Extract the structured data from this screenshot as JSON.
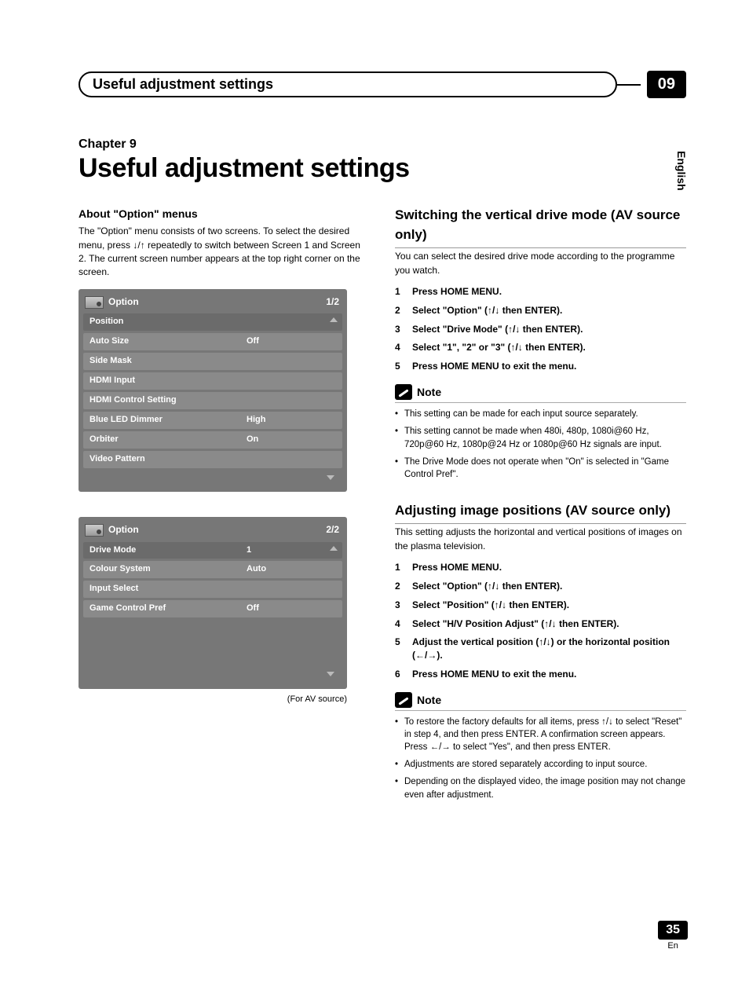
{
  "header": {
    "title": "Useful adjustment settings",
    "chapter_num": "09"
  },
  "language_tab": "English",
  "chapter_label": "Chapter 9",
  "page_title": "Useful adjustment settings",
  "left": {
    "about_head": "About \"Option\" menus",
    "about_text": "The \"Option\" menu consists of two screens. To select the desired menu, press ↓/↑ repeatedly to switch between Screen 1 and Screen 2. The current screen number appears at the top right corner on the screen.",
    "menu1": {
      "title": "Option",
      "page": "1/2",
      "rows": [
        {
          "label": "Position",
          "val": ""
        },
        {
          "label": "Auto Size",
          "val": "Off"
        },
        {
          "label": "Side Mask",
          "val": ""
        },
        {
          "label": "HDMI Input",
          "val": ""
        },
        {
          "label": "HDMI Control Setting",
          "val": ""
        },
        {
          "label": "Blue LED Dimmer",
          "val": "High"
        },
        {
          "label": "Orbiter",
          "val": "On"
        },
        {
          "label": "Video Pattern",
          "val": ""
        }
      ]
    },
    "menu2": {
      "title": "Option",
      "page": "2/2",
      "rows": [
        {
          "label": "Drive Mode",
          "val": "1"
        },
        {
          "label": "Colour System",
          "val": "Auto"
        },
        {
          "label": "Input Select",
          "val": ""
        },
        {
          "label": "Game Control Pref",
          "val": "Off"
        }
      ]
    },
    "caption": "(For AV source)"
  },
  "right": {
    "sec1": {
      "head": "Switching the vertical drive mode (AV source only)",
      "intro": "You can select the desired drive mode according to the programme you watch.",
      "steps": [
        "Press HOME MENU.",
        "Select \"Option\" (↑/↓ then ENTER).",
        "Select \"Drive Mode\" (↑/↓ then ENTER).",
        "Select  \"1\", \"2\" or \"3\" (↑/↓ then ENTER).",
        "Press HOME MENU to exit the menu."
      ],
      "note_label": "Note",
      "notes": [
        "This setting can be made for each input source separately.",
        "This setting cannot be made when 480i, 480p, 1080i@60 Hz, 720p@60 Hz, 1080p@24 Hz or 1080p@60 Hz signals are input.",
        "The Drive Mode does not operate when \"On\" is selected in \"Game Control Pref\"."
      ]
    },
    "sec2": {
      "head": "Adjusting image positions (AV source only)",
      "intro": "This setting adjusts the horizontal and vertical positions of images on the plasma television.",
      "steps": [
        "Press HOME MENU.",
        "Select \"Option\" (↑/↓ then ENTER).",
        "Select \"Position\" (↑/↓ then ENTER).",
        "Select \"H/V Position Adjust\" (↑/↓ then ENTER).",
        "Adjust the vertical position (↑/↓) or the horizontal position (←/→).",
        "Press HOME MENU to exit the menu."
      ],
      "note_label": "Note",
      "notes": [
        "To restore the factory defaults for all items, press ↑/↓ to select \"Reset\" in step 4, and then press ENTER. A confirmation screen appears. Press ←/→ to select \"Yes\", and then press ENTER.",
        "Adjustments are stored separately according to input source.",
        "Depending on the displayed video, the image position may not change even after adjustment."
      ]
    }
  },
  "footer": {
    "page": "35",
    "lang": "En"
  }
}
